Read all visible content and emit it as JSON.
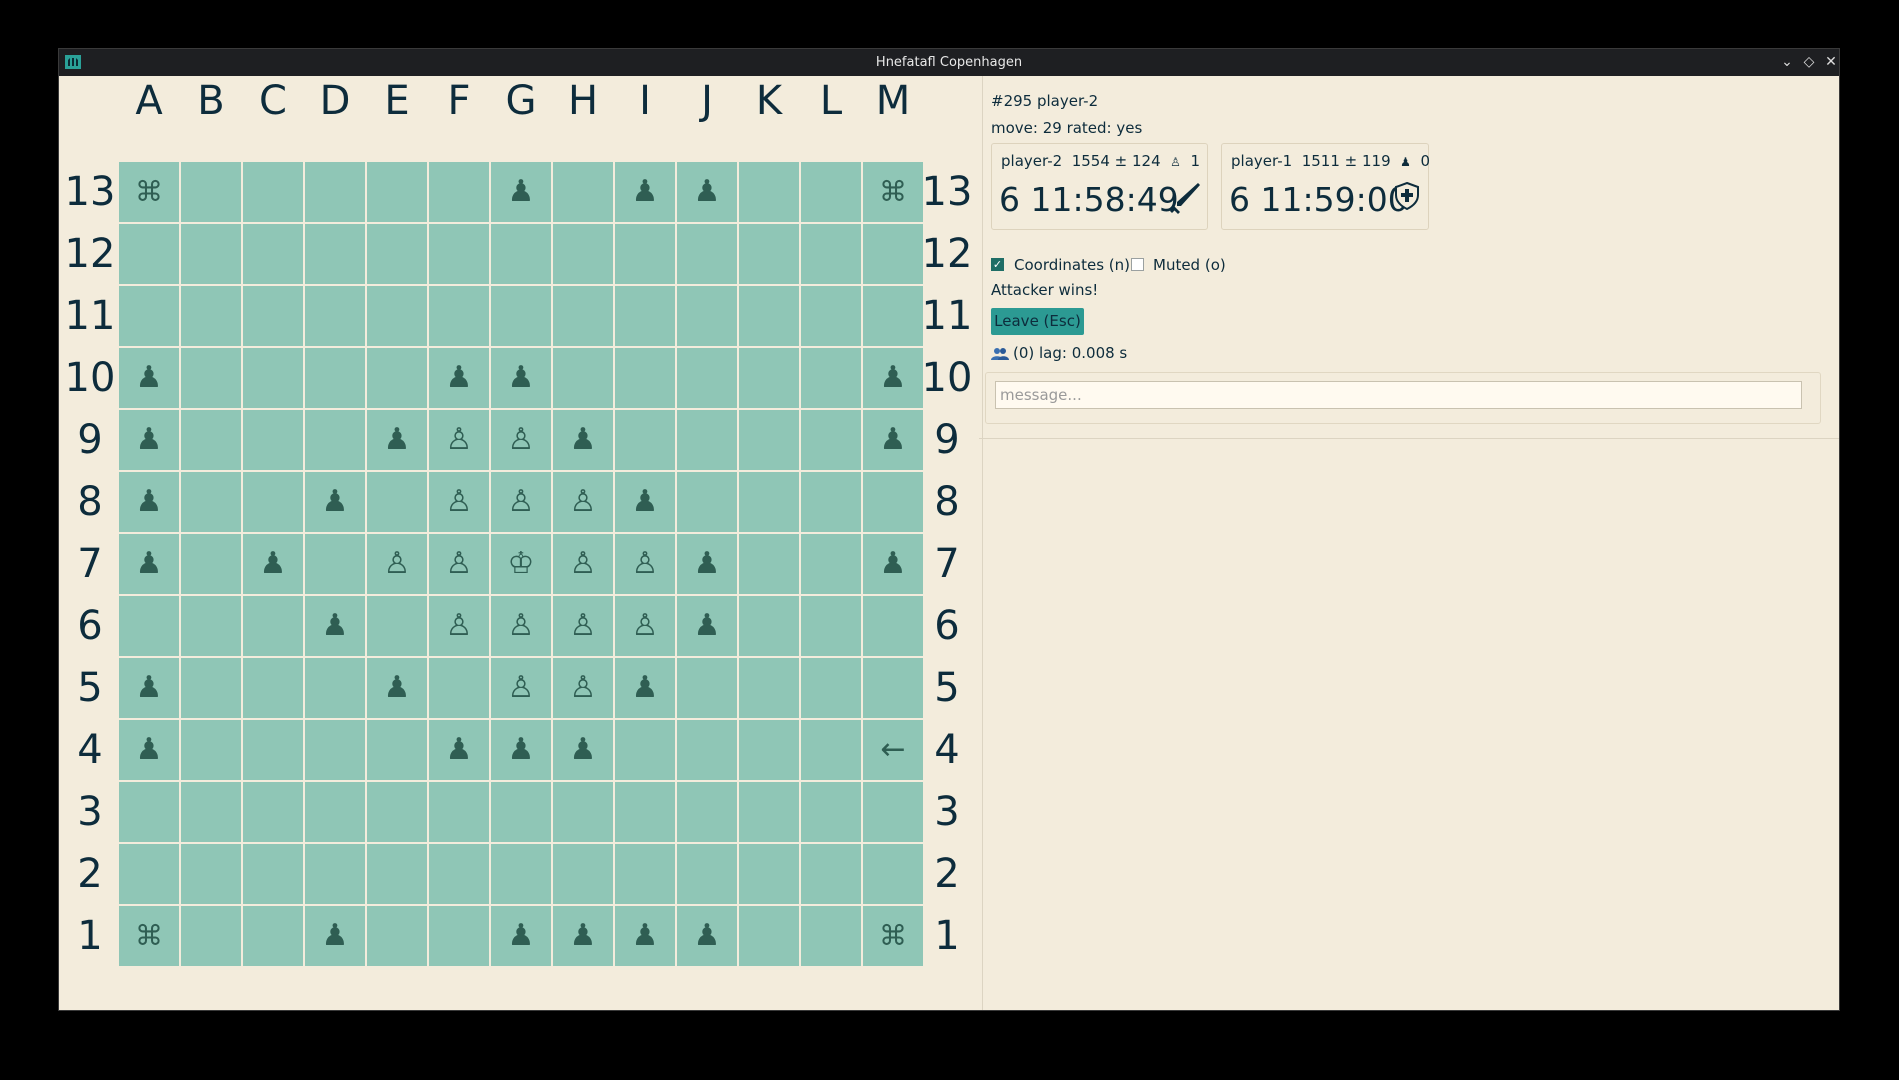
{
  "window": {
    "title": "Hnefatafl Copenhagen",
    "controls": [
      "minimize-icon",
      "maximize-icon",
      "close-icon"
    ]
  },
  "board": {
    "columns": [
      "A",
      "B",
      "C",
      "D",
      "E",
      "F",
      "G",
      "H",
      "I",
      "J",
      "K",
      "L",
      "M"
    ],
    "rows": [
      "13",
      "12",
      "11",
      "10",
      "9",
      "8",
      "7",
      "6",
      "5",
      "4",
      "3",
      "2",
      "1"
    ],
    "cells": [
      "X  . . . . . a . a a . . X",
      ". . . . . . . . . . . . .",
      ". . . . . . . . . . . . .",
      "a . . . . a a . . . . . a",
      "a . . . a d d a . . . . a",
      "a . . a . d d d a . . . .",
      "a . a . d d K d d a . . a",
      ". . . a . d d d d a . . .",
      "a . . . a . d d a . . . .",
      "a . . . . a a a . . . . <",
      ". . . . . . . . . . . . .",
      ". . . . . . . . . . . . .",
      "X . . a . . a a a a . . X"
    ],
    "glyphs": {
      "attacker": "♟",
      "defender": "♙",
      "king": "♔",
      "corner": "⌘",
      "last_move": "←"
    },
    "cell_color": "#8fc6b6",
    "piece_color": "#2f5e53"
  },
  "game": {
    "id_line": "#295 player-2",
    "move_line": "move: 29 rated: yes",
    "status": "Attacker wins!",
    "lag": "(0) lag: 0.008 s"
  },
  "players": [
    {
      "name": "player-2",
      "rating": "1554 ± 124",
      "captured_icon": "♙",
      "captured": "1",
      "clock": "6 11:58:49",
      "role_icon": "sword-icon"
    },
    {
      "name": "player-1",
      "rating": "1511 ± 119",
      "captured_icon": "♟",
      "captured": "0",
      "clock": "6 11:59:00",
      "role_icon": "shield-icon"
    }
  ],
  "options": {
    "coordinates_label": "Coordinates (n)",
    "coordinates_checked": true,
    "muted_label": "Muted (o)",
    "muted_checked": false
  },
  "leave_label": "Leave (Esc)",
  "chat": {
    "placeholder": "message..."
  },
  "colors": {
    "accent": "#2c9a93",
    "background": "#f3ecdc",
    "text": "#0d2c3c"
  }
}
